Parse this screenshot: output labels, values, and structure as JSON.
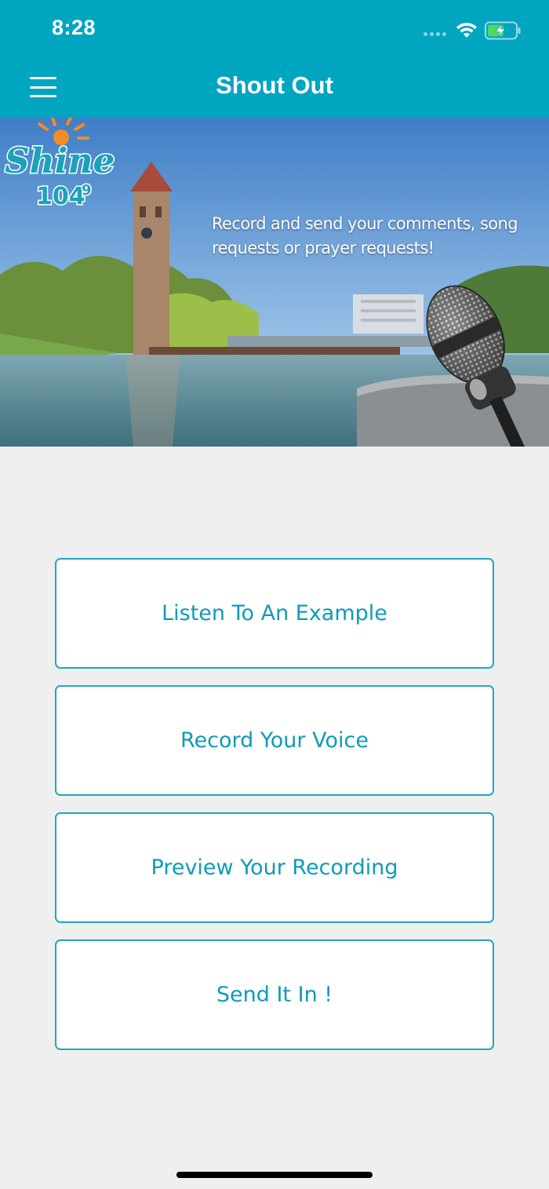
{
  "status_bar": {
    "time": "8:28",
    "icons": [
      "signal-icon",
      "wifi-icon",
      "battery-charging-icon"
    ]
  },
  "nav": {
    "title": "Shout Out",
    "menu_icon": "hamburger-menu-icon"
  },
  "banner": {
    "caption_line1": "Record and send your comments, song",
    "caption_line2": "requests or prayer requests!",
    "logo_text": "Shine",
    "logo_number": "104",
    "logo_decimal": "9"
  },
  "actions": [
    {
      "label": "Listen To An Example"
    },
    {
      "label": "Record Your Voice"
    },
    {
      "label": "Preview Your Recording"
    },
    {
      "label": "Send It In !"
    }
  ],
  "colors": {
    "header": "#00a5c0",
    "button_border": "#1fa8c4",
    "button_text": "#0f9bb8",
    "background": "#efefef"
  }
}
